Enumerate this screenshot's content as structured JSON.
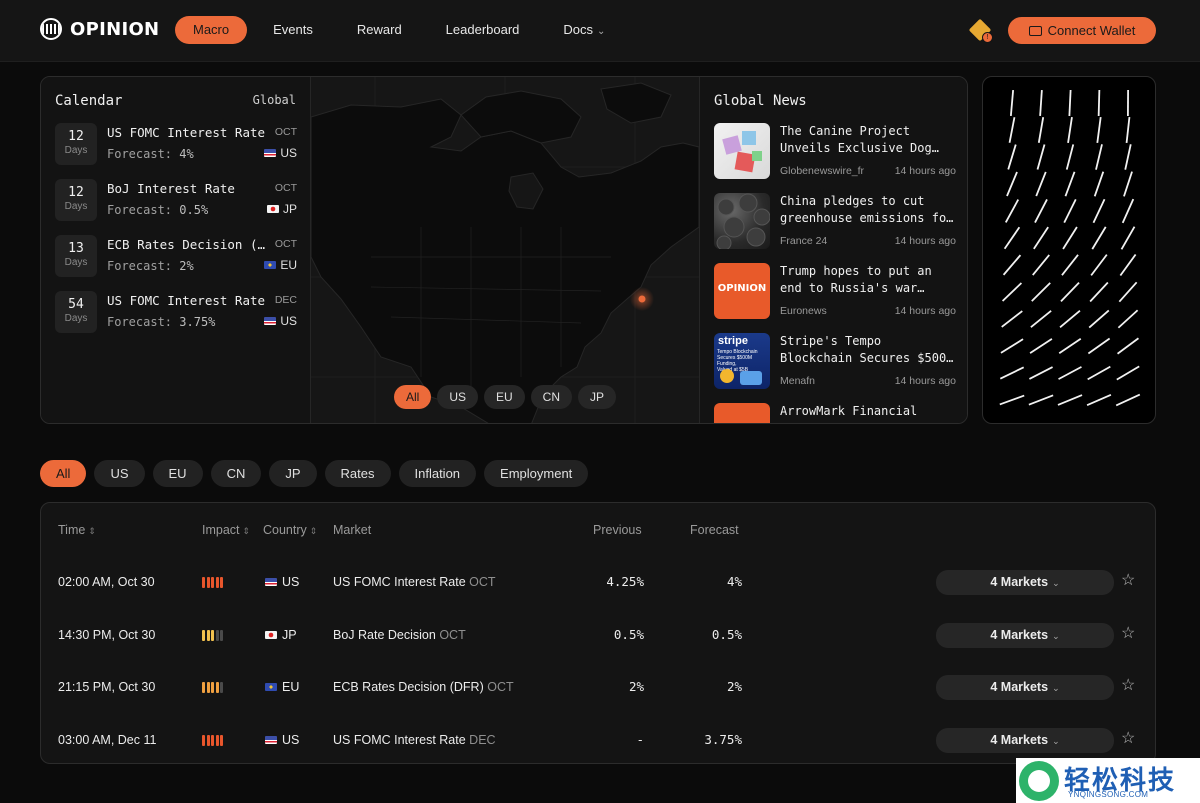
{
  "brand": {
    "name": "OPINION"
  },
  "nav": {
    "items": [
      {
        "label": "Macro",
        "active": true
      },
      {
        "label": "Events",
        "active": false
      },
      {
        "label": "Reward",
        "active": false
      },
      {
        "label": "Leaderboard",
        "active": false
      },
      {
        "label": "Docs",
        "active": false,
        "dropdown": true
      }
    ],
    "chain_icon": "bnb-chain-icon",
    "chain_badge": "!",
    "connect_label": "Connect Wallet"
  },
  "calendar": {
    "title": "Calendar",
    "scope": "Global",
    "forecast_label": "Forecast:",
    "items": [
      {
        "days": "12",
        "days_label": "Days",
        "name": "US FOMC Interest Rate",
        "month": "OCT",
        "forecast": "4%",
        "country": "US",
        "flag": "us"
      },
      {
        "days": "12",
        "days_label": "Days",
        "name": "BoJ Interest Rate",
        "month": "OCT",
        "forecast": "0.5%",
        "country": "JP",
        "flag": "jp"
      },
      {
        "days": "13",
        "days_label": "Days",
        "name": "ECB Rates Decision (DFR)",
        "month": "OCT",
        "forecast": "2%",
        "country": "EU",
        "flag": "eu"
      },
      {
        "days": "54",
        "days_label": "Days",
        "name": "US FOMC Interest Rate",
        "month": "DEC",
        "forecast": "3.75%",
        "country": "US",
        "flag": "us"
      }
    ]
  },
  "map": {
    "filters": [
      {
        "label": "All",
        "active": true
      },
      {
        "label": "US",
        "active": false
      },
      {
        "label": "EU",
        "active": false
      },
      {
        "label": "CN",
        "active": false
      },
      {
        "label": "JP",
        "active": false
      }
    ],
    "marker_color": "#ec6a3a"
  },
  "news": {
    "title": "Global News",
    "items": [
      {
        "headline": "The Canine Project Unveils Exclusive Dog…",
        "source": "Globenewswire_fr",
        "time": "14 hours ago",
        "thumb": "boxes"
      },
      {
        "headline": "China pledges to cut greenhouse emissions fo…",
        "source": "France 24",
        "time": "14 hours ago",
        "thumb": "coal"
      },
      {
        "headline": "Trump hopes to put an end to Russia's war…",
        "source": "Euronews",
        "time": "14 hours ago",
        "thumb": "opinion"
      },
      {
        "headline": "Stripe's Tempo Blockchain Secures $500…",
        "source": "Menafn",
        "time": "14 hours ago",
        "thumb": "stripe",
        "thumb_text": {
          "brand": "stripe",
          "line1": "Tempo Blockchain",
          "line2": "Secures $500M Funding,",
          "line3": "Valued at $5B"
        }
      },
      {
        "headline": "ArrowMark Financial",
        "source": "",
        "time": "",
        "thumb": "opinion"
      }
    ],
    "thumb_logo_text": "OPINION"
  },
  "filters": [
    {
      "label": "All",
      "active": true
    },
    {
      "label": "US",
      "active": false
    },
    {
      "label": "EU",
      "active": false
    },
    {
      "label": "CN",
      "active": false
    },
    {
      "label": "JP",
      "active": false
    },
    {
      "label": "Rates",
      "active": false
    },
    {
      "label": "Inflation",
      "active": false
    },
    {
      "label": "Employment",
      "active": false
    }
  ],
  "table": {
    "headers": {
      "time": "Time",
      "impact": "Impact",
      "country": "Country",
      "market": "Market",
      "previous": "Previous",
      "forecast": "Forecast"
    },
    "rows": [
      {
        "time": "02:00 AM, Oct 30",
        "impact": 5,
        "impact_colors": [
          "#e8562c",
          "#e8562c",
          "#e8562c",
          "#e8562c",
          "#e8562c"
        ],
        "country": "US",
        "flag": "us",
        "market": "US FOMC Interest Rate",
        "month": "OCT",
        "previous": "4.25%",
        "forecast": "4%",
        "markets": "4 Markets"
      },
      {
        "time": "14:30 PM, Oct 30",
        "impact": 3,
        "impact_colors": [
          "#f2c14e",
          "#f2c14e",
          "#f2c14e",
          "#4a4a4a",
          "#4a4a4a"
        ],
        "country": "JP",
        "flag": "jp",
        "market": "BoJ Rate Decision",
        "month": "OCT",
        "previous": "0.5%",
        "forecast": "0.5%",
        "markets": "4 Markets"
      },
      {
        "time": "21:15 PM, Oct 30",
        "impact": 4,
        "impact_colors": [
          "#f0a040",
          "#f0a040",
          "#f0a040",
          "#f0a040",
          "#4a4a4a"
        ],
        "country": "EU",
        "flag": "eu",
        "market": "ECB Rates Decision (DFR)",
        "month": "OCT",
        "previous": "2%",
        "forecast": "2%",
        "markets": "4 Markets"
      },
      {
        "time": "03:00 AM, Dec 11",
        "impact": 5,
        "impact_colors": [
          "#e8562c",
          "#e8562c",
          "#e8562c",
          "#e8562c",
          "#e8562c"
        ],
        "country": "US",
        "flag": "us",
        "market": "US FOMC Interest Rate",
        "month": "DEC",
        "previous": "-",
        "forecast": "3.75%",
        "markets": "4 Markets"
      }
    ]
  },
  "watermark": {
    "text": "轻松科技",
    "sub": "YNQINGSONG.COM"
  },
  "colors": {
    "accent": "#ec6a3a",
    "bg": "#0b0b0b",
    "card": "#131313"
  }
}
